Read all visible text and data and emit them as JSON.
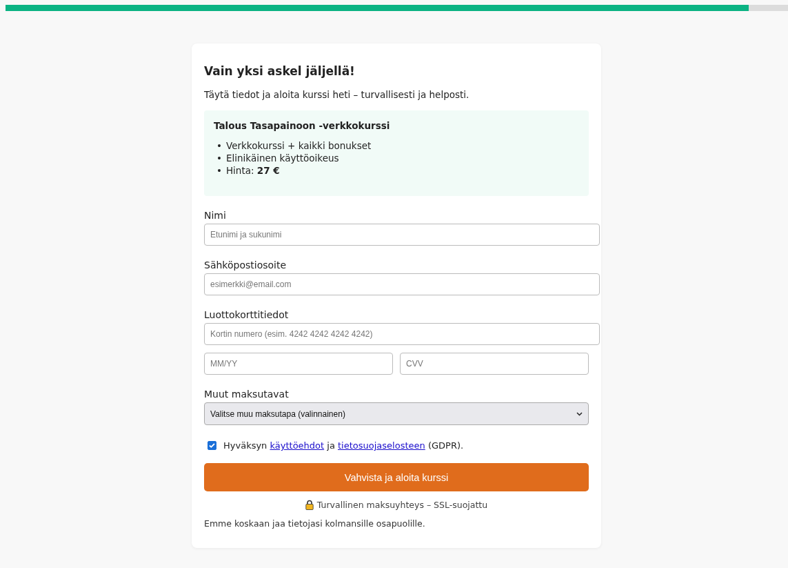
{
  "progress": {
    "level": 0.95
  },
  "heading": "Vain yksi askel jäljellä!",
  "subtitle": "Täytä tiedot ja aloita kurssi heti – turvallisesti ja helposti.",
  "product": {
    "title": "Talous Tasapainoon -verkkokurssi",
    "features": [
      {
        "marker": "•",
        "text": "Verkkokurssi + kaikki bonukset"
      },
      {
        "marker": "•",
        "text": "Elinikäinen käyttöoikeus"
      },
      {
        "marker": "•",
        "text": "Hinta: **27 €**"
      }
    ]
  },
  "fields": [
    {
      "label": "Nimi",
      "placeholder": "Etunimi ja sukunimi",
      "kind": "wide"
    },
    {
      "label": "Sähköpostiosoite",
      "placeholder": "esimerkki@email.com",
      "kind": "wide"
    },
    {
      "label": "Luottokorttitiedot",
      "placeholder": "Kortin numero (esim. 4242 4242 4242 4242)",
      "kind": "wide"
    }
  ],
  "card_row": [
    {
      "placeholder": "MM/YY"
    },
    {
      "placeholder": "CVV"
    }
  ],
  "other_methods": {
    "label": "Muut maksutavat",
    "value": "Valitse muu maksutapa (valinnainen)"
  },
  "consent": {
    "checked": true,
    "segments": [
      {
        "kind": "text",
        "text": "Hyväksyn "
      },
      {
        "kind": "link",
        "text": "käyttöehdot"
      },
      {
        "kind": "text",
        "text": " ja "
      },
      {
        "kind": "link",
        "text": "tietosuojaselosteen"
      },
      {
        "kind": "text",
        "text": " (GDPR)."
      }
    ]
  },
  "submit": "Vahvista ja aloita kurssi",
  "secure_note": "Turvallinen maksuyhteys – SSL-suojattu",
  "privacy_note": "Emme koskaan jaa tietojasi kolmansille osapuolille."
}
